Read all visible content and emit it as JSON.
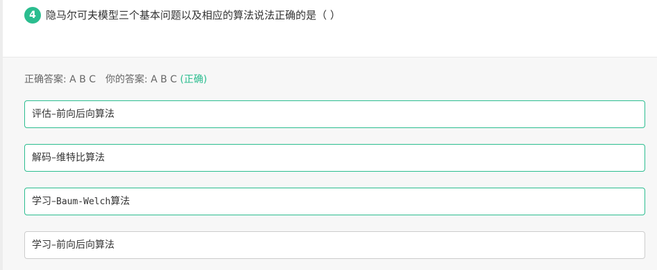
{
  "question": {
    "number": "4",
    "text": "隐马尔可夫模型三个基本问题以及相应的算法说法正确的是（  ）"
  },
  "answer": {
    "correct_label": "正确答案: A B C",
    "yours_label": "你的答案: A B C",
    "result": "(正确)"
  },
  "options": [
    {
      "prefix": "评估",
      "text": "前向后向算法",
      "selected": true
    },
    {
      "prefix": "解码",
      "text": "维特比算法",
      "selected": true
    },
    {
      "prefix": "学习",
      "text": "Baum-Welch",
      "suffix": "算法",
      "selected": true
    },
    {
      "prefix": "学习",
      "text": "前向后向算法",
      "selected": false
    }
  ],
  "colors": {
    "accent": "#2bbd8f",
    "border_default": "#cccccc"
  }
}
